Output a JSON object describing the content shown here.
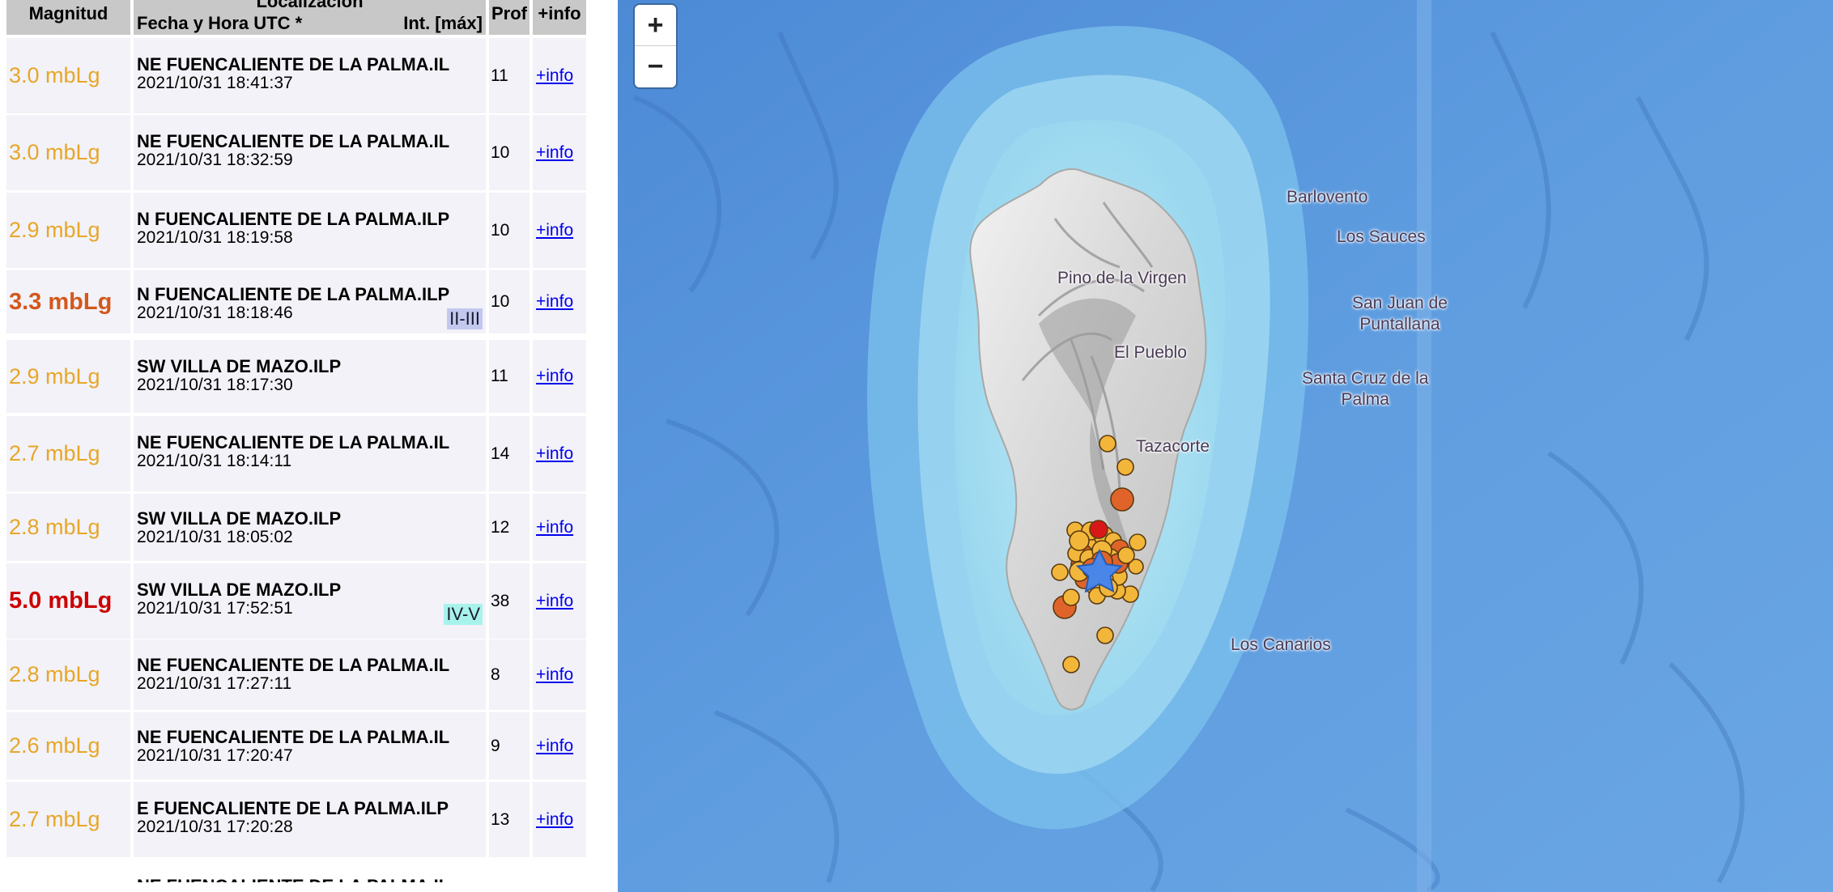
{
  "table": {
    "headers": {
      "magnitude": "Magnitud",
      "location": "Localización",
      "datetime": "Fecha y Hora UTC *",
      "intensity": "Int. [máx]",
      "depth": "Prof",
      "info": "+info"
    },
    "rows": [
      {
        "mag": "3.0 mbLg",
        "place": "NE FUENCALIENTE DE LA PALMA.IL",
        "date": "2021/10/31 18:41:37",
        "depth": "11",
        "intensity": "",
        "info": "+info"
      },
      {
        "mag": "3.0 mbLg",
        "place": "NE FUENCALIENTE DE LA PALMA.IL",
        "date": "2021/10/31 18:32:59",
        "depth": "10",
        "intensity": "",
        "info": "+info"
      },
      {
        "mag": "2.9 mbLg",
        "place": "N FUENCALIENTE DE LA PALMA.ILP",
        "date": "2021/10/31 18:19:58",
        "depth": "10",
        "intensity": "",
        "info": "+info"
      },
      {
        "mag": "3.3 mbLg",
        "place": "N FUENCALIENTE DE LA PALMA.ILP",
        "date": "2021/10/31 18:18:46",
        "depth": "10",
        "intensity": "II-III",
        "info": "+info"
      },
      {
        "mag": "2.9 mbLg",
        "place": "SW VILLA DE MAZO.ILP",
        "date": "2021/10/31 18:17:30",
        "depth": "11",
        "intensity": "",
        "info": "+info"
      },
      {
        "mag": "2.7 mbLg",
        "place": "NE FUENCALIENTE DE LA PALMA.IL",
        "date": "2021/10/31 18:14:11",
        "depth": "14",
        "intensity": "",
        "info": "+info"
      },
      {
        "mag": "2.8 mbLg",
        "place": "SW VILLA DE MAZO.ILP",
        "date": "2021/10/31 18:05:02",
        "depth": "12",
        "intensity": "",
        "info": "+info"
      },
      {
        "mag": "5.0 mbLg",
        "place": "SW VILLA DE MAZO.ILP",
        "date": "2021/10/31 17:52:51",
        "depth": "38",
        "intensity": "IV-V",
        "info": "+info"
      },
      {
        "mag": "2.8 mbLg",
        "place": "NE FUENCALIENTE DE LA PALMA.IL",
        "date": "2021/10/31 17:27:11",
        "depth": "8",
        "intensity": "",
        "info": "+info"
      },
      {
        "mag": "2.6 mbLg",
        "place": "NE FUENCALIENTE DE LA PALMA.IL",
        "date": "2021/10/31 17:20:47",
        "depth": "9",
        "intensity": "",
        "info": "+info"
      },
      {
        "mag": "2.7 mbLg",
        "place": "E FUENCALIENTE DE LA PALMA.ILP",
        "date": "2021/10/31 17:20:28",
        "depth": "13",
        "intensity": "",
        "info": "+info"
      }
    ],
    "partial_row_place": "NE FUENCALIENTE DE LA PALMA.IL"
  },
  "colors": {
    "mag_low": "#e8a628",
    "mag_mid": "#d4571c",
    "mag_high": "#cc0000",
    "intensity_ii_iii": "#c2c8ee",
    "intensity_iv_v": "#a8f2ec",
    "link": "#0000ee",
    "ocean": "#5b98dc",
    "quake_fill": "#f2b63a",
    "quake_mid": "#e0642a",
    "quake_high": "#d81818",
    "star": "#4a86e8"
  },
  "map": {
    "zoom_in": "+",
    "zoom_out": "−",
    "towns": {
      "barlovento": "Barlovento",
      "los_sauces": "Los Sauces",
      "pino": "Pino de la Virgen",
      "san_juan_1": "San Juan de",
      "san_juan_2": "Puntallana",
      "el_pueblo": "El Pueblo",
      "santa_cruz_1": "Santa Cruz de la",
      "santa_cruz_2": "Palma",
      "tazacorte": "Tazacorte",
      "los_canarios": "Los Canarios"
    },
    "icons": {
      "zoom_in": "plus-icon",
      "zoom_out": "minus-icon",
      "epicenter": "star-icon"
    }
  }
}
